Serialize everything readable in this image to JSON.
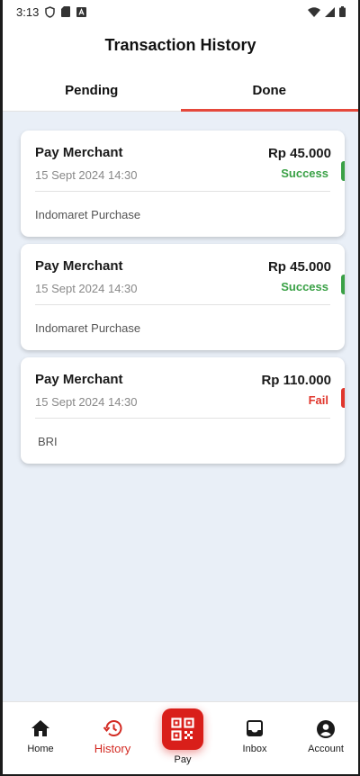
{
  "status_bar": {
    "time": "3:13"
  },
  "header": {
    "title": "Transaction History"
  },
  "tabs": [
    {
      "label": "Pending",
      "active": false
    },
    {
      "label": "Done",
      "active": true
    }
  ],
  "transactions": [
    {
      "title": "Pay Merchant",
      "date": "15 Sept 2024 14:30",
      "amount": "Rp 45.000",
      "status": "Success",
      "description": "Indomaret Purchase"
    },
    {
      "title": "Pay Merchant",
      "date": "15 Sept 2024 14:30",
      "amount": "Rp 45.000",
      "status": "Success",
      "description": "Indomaret Purchase"
    },
    {
      "title": "Pay Merchant",
      "date": "15 Sept 2024 14:30",
      "amount": "Rp 110.000",
      "status": "Fail",
      "description": "BRI"
    }
  ],
  "bottom_nav": {
    "items": [
      {
        "label": "Home",
        "icon": "home-icon",
        "active": false
      },
      {
        "label": "History",
        "icon": "history-icon",
        "active": true
      },
      {
        "label": "Pay",
        "icon": "qr-code-icon",
        "active": false
      },
      {
        "label": "Inbox",
        "icon": "inbox-icon",
        "active": false
      },
      {
        "label": "Account",
        "icon": "account-icon",
        "active": false
      }
    ]
  },
  "colors": {
    "accent": "#d91f1a",
    "tab_indicator": "#e5483b",
    "success": "#3aa146",
    "fail": "#e0362c",
    "content_background": "#e9eff7"
  }
}
